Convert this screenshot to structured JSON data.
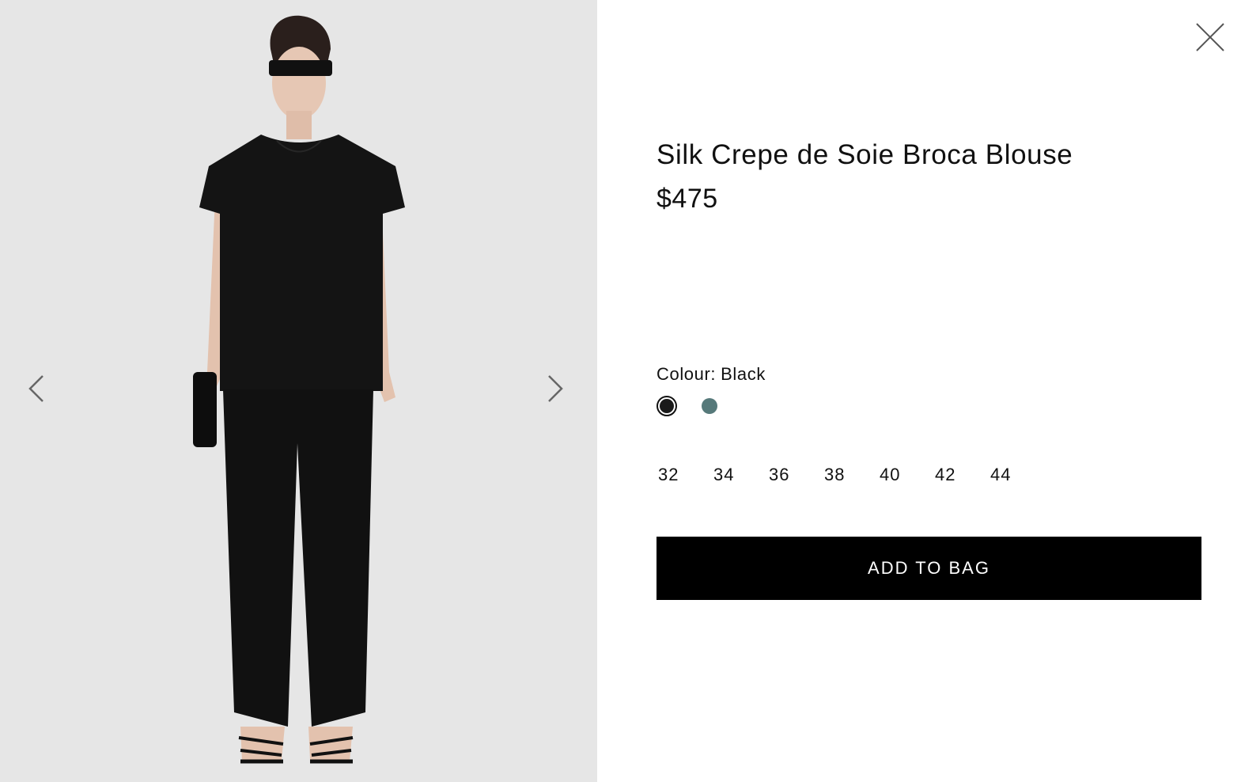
{
  "gallery": {
    "prev_icon": "chevron-left-icon",
    "next_icon": "chevron-right-icon",
    "background": "#e6e6e6"
  },
  "close_icon": "close-icon",
  "product": {
    "title": "Silk Crepe de Soie Broca Blouse",
    "price": "$475"
  },
  "colour": {
    "label": "Colour:",
    "selected_name": "Black",
    "swatches": [
      {
        "color": "#1a1a1a",
        "selected": true
      },
      {
        "color": "#56797a",
        "selected": false
      }
    ]
  },
  "sizes": [
    "32",
    "34",
    "36",
    "38",
    "40",
    "42",
    "44"
  ],
  "cta": {
    "label": "ADD TO BAG"
  }
}
